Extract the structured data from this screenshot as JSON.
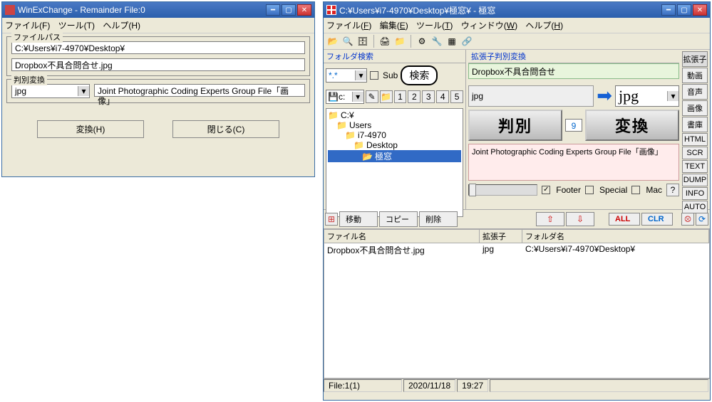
{
  "left": {
    "title": "WinExChange - Remainder File:0",
    "menu": {
      "file": "ファイル(F)",
      "tool": "ツール(T)",
      "help": "ヘルプ(H)"
    },
    "filepath": {
      "legend": "ファイルパス",
      "dir": "C:¥Users¥i7-4970¥Desktop¥",
      "file": "Dropbox不具合問合せ.jpg"
    },
    "convert": {
      "legend": "判別変換",
      "ext": "jpg",
      "desc": "Joint Photographic Coding Experts Group File「画像」"
    },
    "btn_convert": "変換(H)",
    "btn_close": "閉じる(C)"
  },
  "right": {
    "title": "C:¥Users¥i7-4970¥Desktop¥極窓¥ - 極窓",
    "menu": {
      "file": "ファイル(F)",
      "edit": "編集(E)",
      "tool": "ツール(T)",
      "window": "ウィンドウ(W)",
      "help": "ヘルプ(H)"
    },
    "folder_search": {
      "title": "フォルダ検索",
      "pattern": "*.*",
      "sub": "Sub",
      "search": "検索",
      "drive": "c:",
      "nums": [
        "1",
        "2",
        "3",
        "4",
        "5"
      ],
      "tree": [
        "C:¥",
        "Users",
        "i7-4970",
        "Desktop",
        "極窓"
      ]
    },
    "extconv": {
      "title": "拡張子判別変換",
      "filename": "Dropbox不具合問合せ",
      "from_ext": "jpg",
      "to_ext": "jpg",
      "btn_judge": "判別",
      "btn_convert": "変換",
      "count": "9",
      "desc": "Joint Photographic Coding Experts Group File「画像」",
      "footer": "Footer",
      "special": "Special",
      "mac": "Mac",
      "q": "?"
    },
    "sidetabs": [
      "拡張子",
      "動画",
      "音声",
      "画像",
      "書庫",
      "HTML",
      "SCR",
      "TEXT",
      "DUMP",
      "INFO",
      "AUTO"
    ],
    "midbar": {
      "move": "移動",
      "copy": "コピー",
      "delete": "削除",
      "all": "ALL",
      "clr": "CLR"
    },
    "table": {
      "col_file": "ファイル名",
      "col_ext": "拡張子",
      "col_folder": "フォルダ名",
      "row": {
        "file": "Dropbox不具合問合せ.jpg",
        "ext": "jpg",
        "folder": "C:¥Users¥i7-4970¥Desktop¥"
      }
    },
    "status": {
      "files": "File:1(1)",
      "date": "2020/11/18",
      "time": "19:27"
    }
  }
}
